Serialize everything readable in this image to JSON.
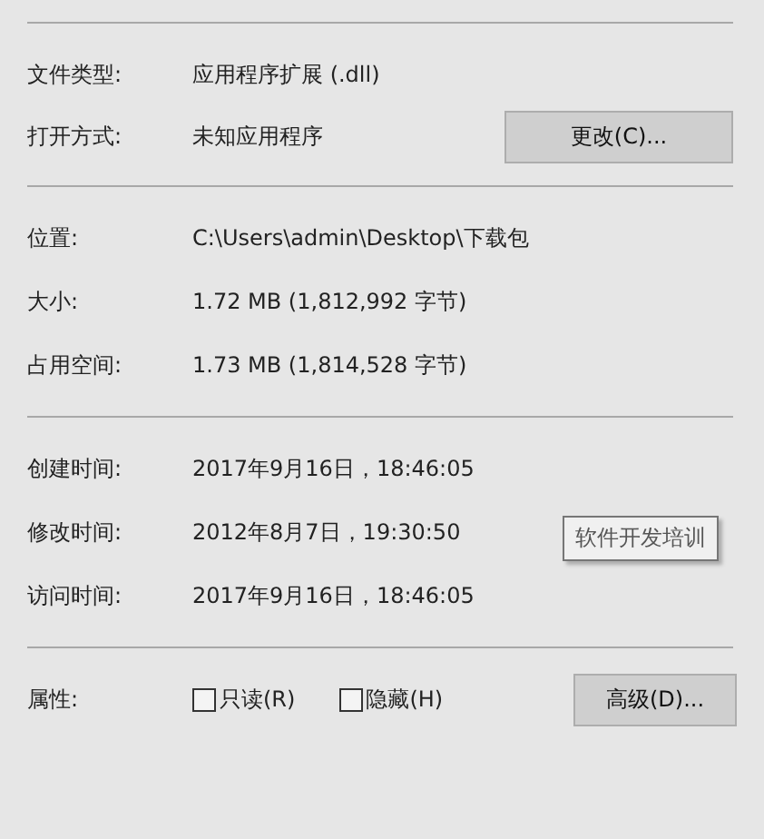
{
  "sections": [
    {
      "rows": [
        {
          "label": "文件类型:",
          "value": "应用程序扩展 (.dll)"
        },
        {
          "label": "打开方式:",
          "value": "未知应用程序",
          "button": "更改(C)..."
        }
      ]
    },
    {
      "rows": [
        {
          "label": "位置:",
          "value": "C:\\Users\\admin\\Desktop\\下载包"
        },
        {
          "label": "大小:",
          "value": "1.72 MB (1,812,992 字节)"
        },
        {
          "label": "占用空间:",
          "value": "1.73 MB (1,814,528 字节)"
        }
      ]
    },
    {
      "rows": [
        {
          "label": "创建时间:",
          "value": "2017年9月16日，18:46:05"
        },
        {
          "label": "修改时间:",
          "value": "2012年8月7日，19:30:50"
        },
        {
          "label": "访问时间:",
          "value": "2017年9月16日，18:46:05"
        }
      ]
    }
  ],
  "attributes": {
    "label": "属性:",
    "checkboxes": [
      {
        "label": "只读(R)",
        "checked": false
      },
      {
        "label": "隐藏(H)",
        "checked": false
      }
    ],
    "button": "高级(D)..."
  },
  "tooltip": "软件开发培训"
}
